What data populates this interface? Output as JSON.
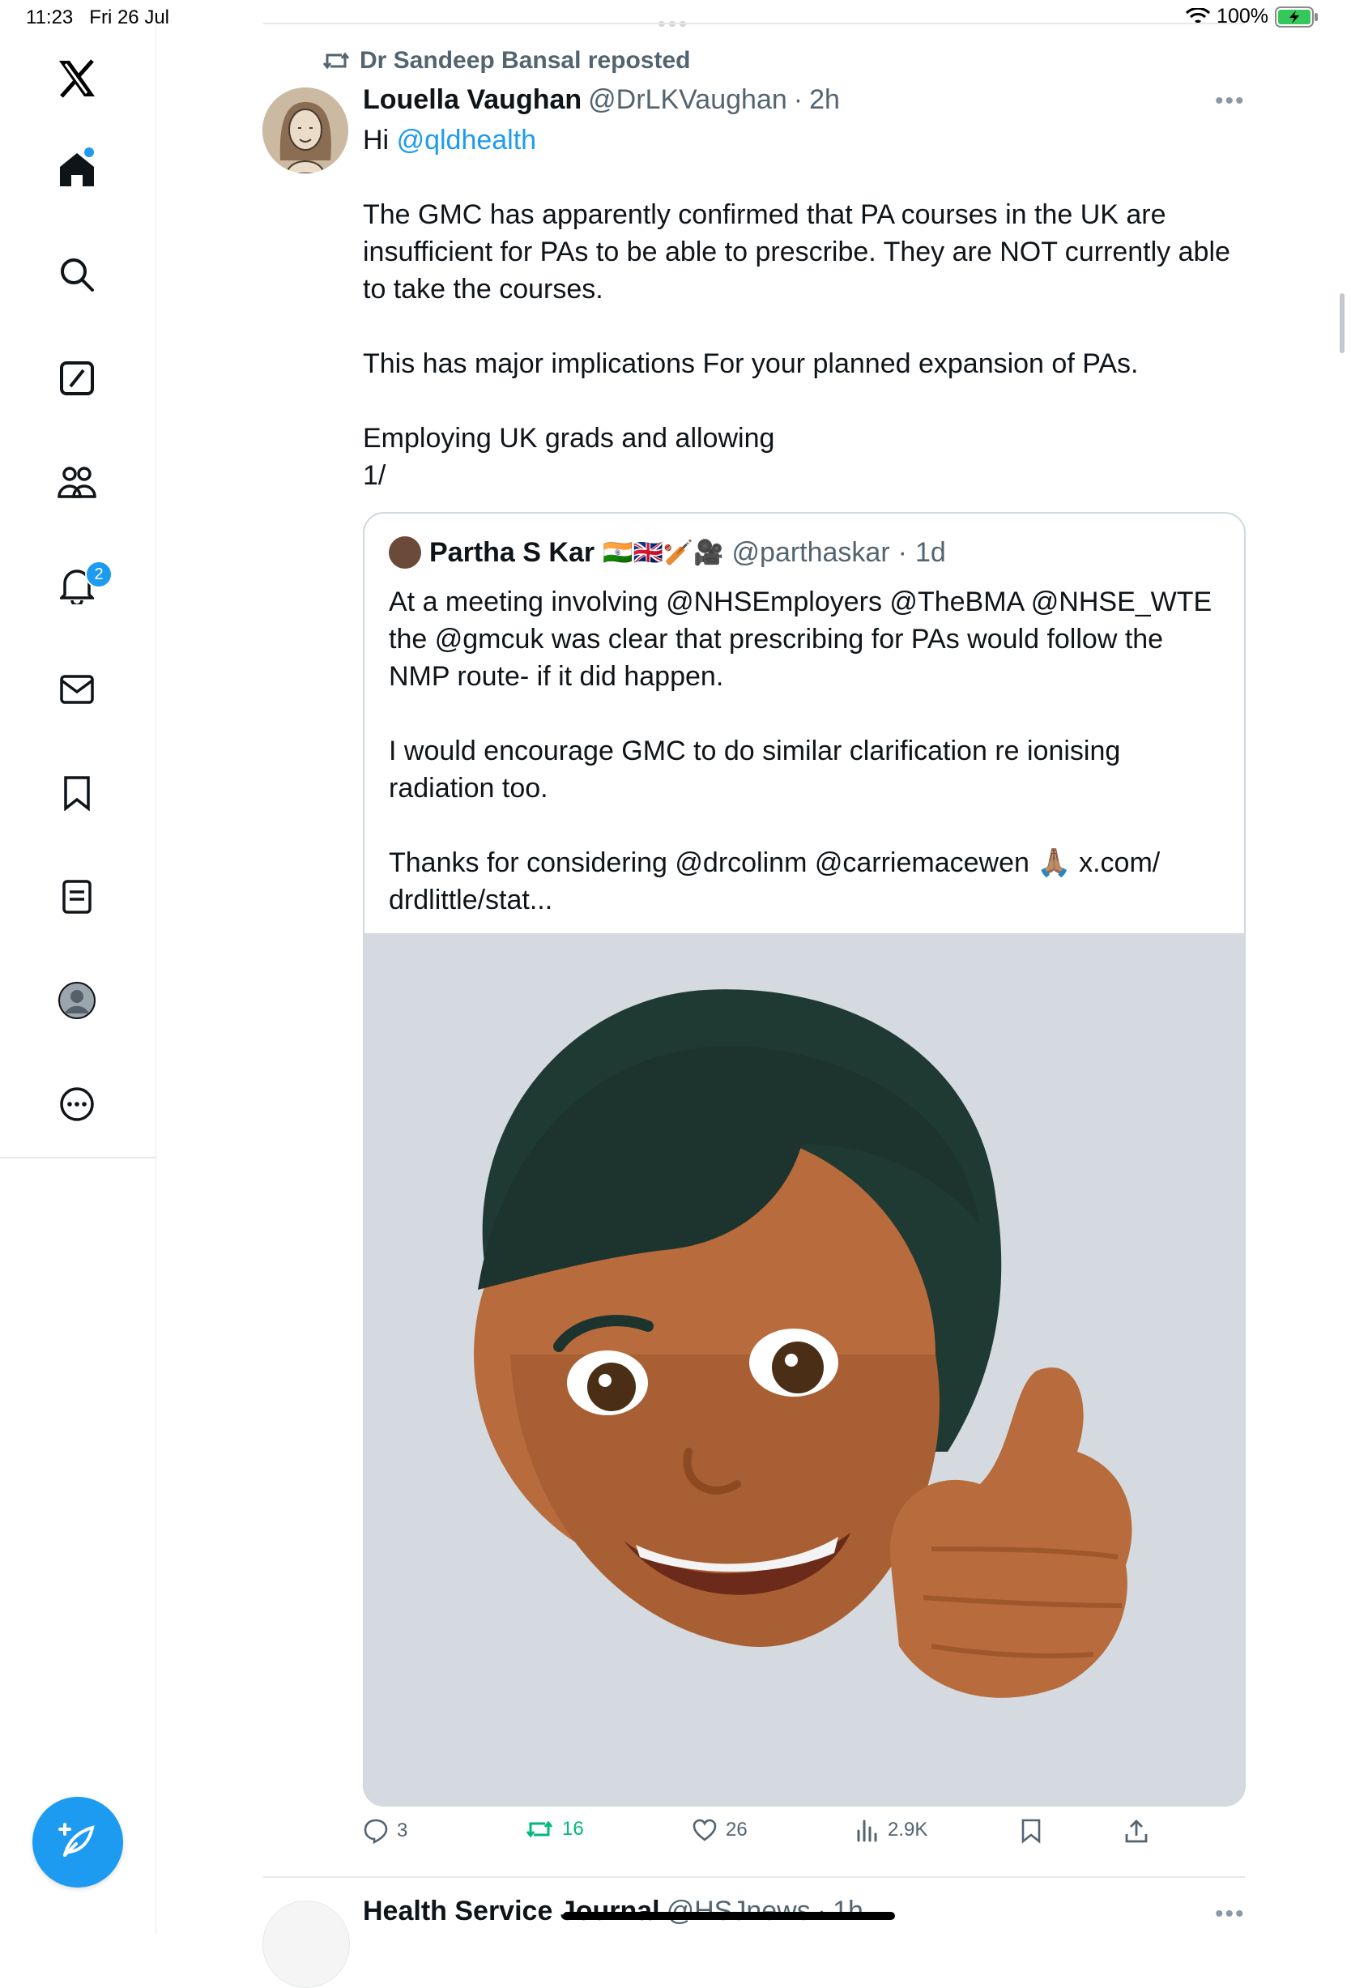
{
  "status": {
    "time": "11:23",
    "date": "Fri 26 Jul",
    "battery": "100%"
  },
  "sidebar": {
    "items": [
      {
        "icon": "x-logo-icon"
      },
      {
        "icon": "home-icon"
      },
      {
        "icon": "search-icon"
      },
      {
        "icon": "grok-icon"
      },
      {
        "icon": "communities-icon"
      },
      {
        "icon": "notifications-icon",
        "badge": "2"
      },
      {
        "icon": "messages-icon"
      },
      {
        "icon": "bookmarks-icon"
      },
      {
        "icon": "lists-icon"
      },
      {
        "icon": "profile-icon"
      },
      {
        "icon": "more-icon"
      }
    ],
    "compose_icon": "compose-post-icon"
  },
  "tweet": {
    "repost_label": "Dr Sandeep Bansal reposted",
    "author_name": "Louella Vaughan",
    "handle": "@DrLKVaughan",
    "separator": "·",
    "time": "2h",
    "text_intro": "Hi ",
    "mention": "@qldhealth",
    "para1": "The GMC has apparently confirmed that PA courses in the  UK  are insufficient for PAs to be able to prescribe. They are NOT currently able to take the courses.",
    "para2": "This has major implications For your planned expansion of PAs.",
    "para3": "Employing UK grads and allowing",
    "para4": "1/"
  },
  "quote": {
    "author_name": "Partha S Kar",
    "flags": "🇮🇳🇬🇧🏏🎥",
    "handle": "@parthaskar",
    "separator": "·",
    "time": "1d",
    "para1": "At a meeting involving @NHSEmployers @TheBMA @NHSE_WTE the @gmcuk was clear that prescribing for PAs would follow the NMP route- if it did happen.",
    "para2": "I would encourage GMC to do similar clarification re ionising radiation too.",
    "para3": "Thanks for considering @drcolinm @carriemacewen 🙏🏽 x.com/ drdlittle/stat...",
    "media_bg": "#d4dadf"
  },
  "actions": {
    "replies": "3",
    "reposts": "16",
    "likes": "26",
    "views": "2.9K"
  },
  "next_tweet": {
    "author_name": "Health Service Journal",
    "handle": "@HSJnews",
    "separator": "·",
    "time": "1h"
  },
  "colors": {
    "accent": "#1d9bf0",
    "repost_green": "#00ba7c",
    "muted": "#536471",
    "text": "#0f1419"
  }
}
